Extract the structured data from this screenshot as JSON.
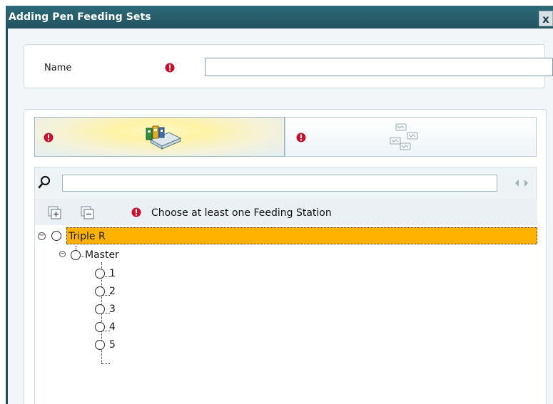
{
  "window": {
    "title": "Adding Pen Feeding Sets",
    "close_label": "x"
  },
  "name_panel": {
    "label": "Name",
    "value": "",
    "placeholder": ""
  },
  "tabs": [
    {
      "icon": "feeding-station-icon",
      "required": true,
      "active": true
    },
    {
      "icon": "pens-icon",
      "required": true,
      "active": false
    }
  ],
  "search": {
    "placeholder": "",
    "value": ""
  },
  "toolbar": {
    "expand_icon": "expand-all-icon",
    "collapse_icon": "collapse-all-icon",
    "hint": "Choose at least one Feeding Station"
  },
  "tree": {
    "root": {
      "label": "Triple R",
      "selected": true
    },
    "group": {
      "label": "Master"
    },
    "items": [
      "1",
      "2",
      "3",
      "4",
      "5"
    ]
  },
  "colors": {
    "titlebar": "#22525f",
    "selection": "#ffb300",
    "required": "#c8102e"
  }
}
